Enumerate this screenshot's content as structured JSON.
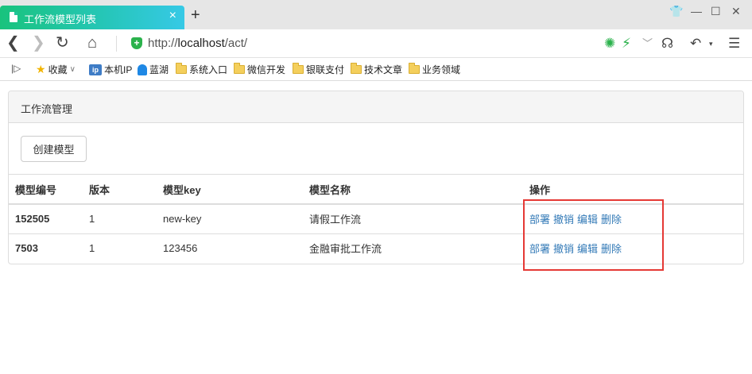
{
  "browser": {
    "tab_title": "工作流模型列表",
    "tab_close": "×",
    "new_tab": "+",
    "url_scheme": "http://",
    "url_host": "localhost",
    "url_path": "/act/"
  },
  "bookmarks": [
    {
      "label": "收藏",
      "icon": "star-icon"
    },
    {
      "label": "本机IP",
      "icon": "ip-icon"
    },
    {
      "label": "蓝湖",
      "icon": "lanhu-icon"
    },
    {
      "label": "系统入口",
      "icon": "folder-icon"
    },
    {
      "label": "微信开发",
      "icon": "folder-icon"
    },
    {
      "label": "银联支付",
      "icon": "folder-icon"
    },
    {
      "label": "技术文章",
      "icon": "folder-icon"
    },
    {
      "label": "业务领域",
      "icon": "folder-icon"
    }
  ],
  "panel": {
    "title": "工作流管理",
    "create_button": "创建模型"
  },
  "table": {
    "headers": [
      "模型编号",
      "版本",
      "模型key",
      "模型名称",
      "操作"
    ],
    "rows": [
      {
        "id": "152505",
        "version": "1",
        "key": "new-key",
        "name": "请假工作流"
      },
      {
        "id": "7503",
        "version": "1",
        "key": "123456",
        "name": "金融审批工作流"
      }
    ],
    "actions": [
      "部署",
      "撤销",
      "编辑",
      "删除"
    ]
  },
  "colors": {
    "link": "#337ab7",
    "highlight": "#e53935",
    "tab_gradient_start": "#19c37d",
    "tab_gradient_end": "#36c9e6"
  }
}
